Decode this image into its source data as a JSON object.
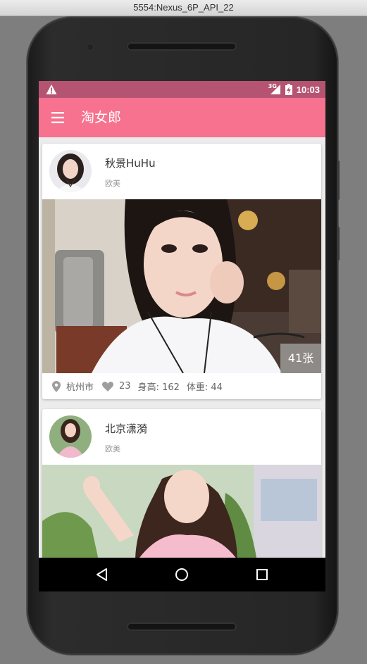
{
  "window": {
    "title": "5554:Nexus_6P_API_22"
  },
  "status_bar": {
    "network": "3G",
    "time": "10:03",
    "color": "#b55472"
  },
  "app_bar": {
    "title": "淘女郎",
    "color": "#f6728f"
  },
  "cards": [
    {
      "name": "秋景HuHu",
      "tag": "欧美",
      "photo_count": "41张",
      "city": "杭州市",
      "likes": "23",
      "height_label": "身高: 162",
      "weight_label": "体重: 44"
    },
    {
      "name": "北京潇漪",
      "tag": "欧美"
    }
  ],
  "icons": {
    "menu": "hamburger-icon",
    "location": "location-pin-icon",
    "like": "heart-icon",
    "nav_back": "triangle-back-icon",
    "nav_home": "circle-home-icon",
    "nav_recents": "square-recents-icon"
  }
}
